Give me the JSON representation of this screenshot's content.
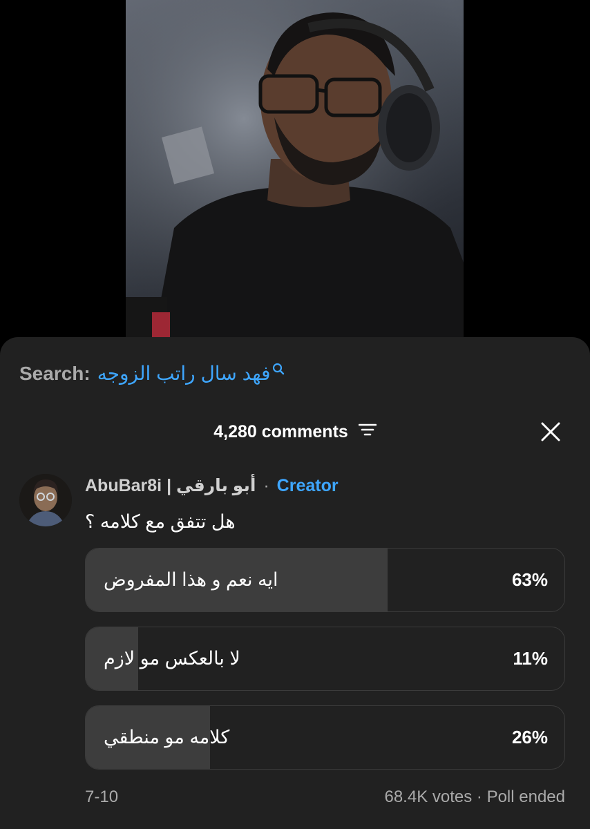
{
  "search": {
    "prefix": "Search:",
    "query": "فهد سال راتب الزوجه"
  },
  "comments_header": {
    "count_label": "4,280 comments"
  },
  "post": {
    "author_name": "AbuBar8i | أبو بارقي",
    "separator": "·",
    "badge": "Creator",
    "question": "هل تتفق مع كلامه ؟",
    "options": [
      {
        "label": "ايه نعم و هذا المفروض",
        "percent": "63%",
        "fraction": 0.63
      },
      {
        "label": "لا بالعكس مو لازم",
        "percent": "11%",
        "fraction": 0.11
      },
      {
        "label": "كلامه مو منطقي",
        "percent": "26%",
        "fraction": 0.26
      }
    ],
    "date": "7-10",
    "votes_status": "68.4K votes · Poll ended"
  },
  "colors": {
    "sheet_bg": "#212121",
    "accent_blue": "#3ea6ff",
    "poll_fill": "#3d3d3d",
    "muted_text": "#aaaaaa"
  },
  "icons": {
    "search": "search-icon",
    "sort": "sort-icon",
    "close": "close-icon"
  }
}
